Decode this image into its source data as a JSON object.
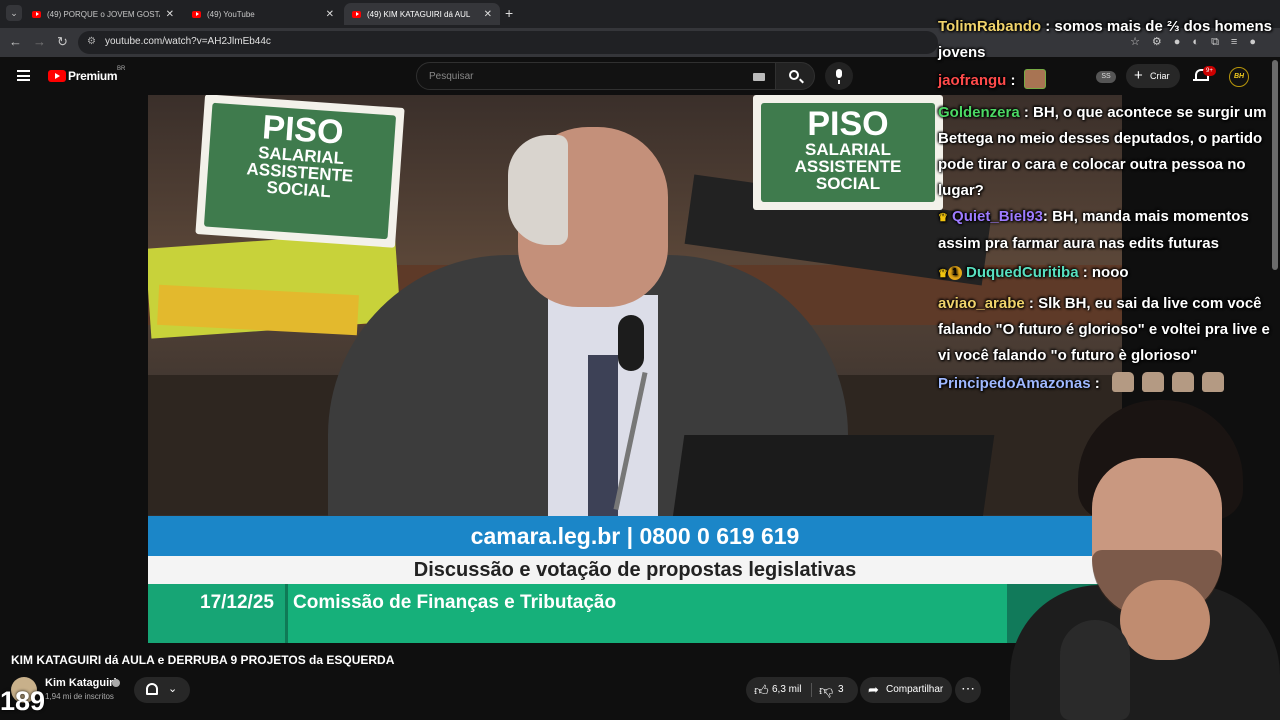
{
  "browser": {
    "tabs": [
      {
        "title": "(49) PORQUE o JOVEM GOSTA",
        "active": false
      },
      {
        "title": "(49) YouTube",
        "active": false
      },
      {
        "title": "(49) KIM KATAGUIRI dá AUL",
        "active": true
      }
    ],
    "url": "youtube.com/watch?v=AH2JlmEb44c"
  },
  "youtube": {
    "brand": "Premium",
    "country": "BR",
    "search_placeholder": "Pesquisar",
    "create_label": "Criar",
    "notification_count": "9+",
    "ss_label": "SS",
    "avatar_label": "BH"
  },
  "video": {
    "sign_title": "PISO",
    "sign_sub1": "SALARIAL",
    "sign_sub2": "ASSISTENTE",
    "sign_sub3": "SOCIAL",
    "banner_line": "camara.leg.br | 0800 0 619 619",
    "banner_subject": "Discussão e votação de propostas legislativas",
    "banner_date": "17/12/25",
    "banner_commission": "Comissão de Finanças e Tributação"
  },
  "chat": [
    {
      "user": "TolimRabando",
      "color": "#f0d36b",
      "text": "somos mais de ⅔ dos homens jovens"
    },
    {
      "user": "jaofrangu",
      "color": "#ff4b4b",
      "text": ""
    },
    {
      "user": "Goldenzera",
      "color": "#4cd964",
      "text": "BH, o que acontece se surgir um Bettega no meio desses deputados, o partido pode tirar o cara e colocar outra pessoa no lugar?"
    },
    {
      "user": "Quiet_Biel93",
      "color": "#9d7bff",
      "text": "BH, manda mais momentos assim pra farmar aura nas edits futuras"
    },
    {
      "user": "DuquedCuritiba",
      "color": "#58e0c0",
      "text": "nooo"
    },
    {
      "user": "aviao_arabe",
      "color": "#f0d36b",
      "text": "Slk BH, eu sai da live com você falando \"O futuro é glorioso\" e voltei pra live e vi você falando \"o futuro è glorioso\""
    },
    {
      "user": "PrincipedoAmazonas",
      "color": "#9fb8ff",
      "text": ""
    }
  ],
  "below": {
    "title": "KIM KATAGUIRI dá AULA e DERRUBA 9 PROJETOS da ESQUERDA",
    "channel": "Kim Kataguiri",
    "subscribers": "1,94 mi de inscritos",
    "viewers": "189",
    "likes": "6,3 mil",
    "dislikes": "3",
    "share": "Compartilhar"
  },
  "icons": [
    "tab-search-icon",
    "youtube-favicon-icon",
    "back-icon",
    "forward-icon",
    "reload-icon",
    "site-info-icon",
    "hamburger-icon",
    "youtube-logo-icon",
    "keyboard-icon",
    "search-icon",
    "mic-icon",
    "plus-icon",
    "bell-icon",
    "thumbs-up-icon",
    "thumbs-down-icon",
    "share-icon",
    "more-icon",
    "crown-icon",
    "medal-icon"
  ]
}
